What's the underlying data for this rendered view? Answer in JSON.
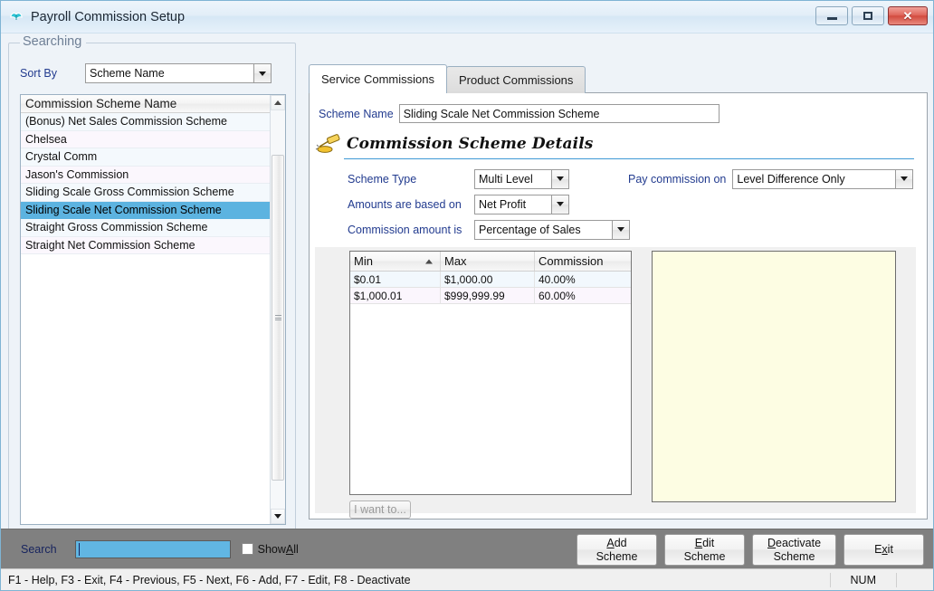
{
  "window": {
    "title": "Payroll Commission Setup",
    "icon": "butterfly-icon",
    "minimize_label": "",
    "maximize_label": "",
    "close_label": "✕"
  },
  "search_panel": {
    "legend": "Searching",
    "sort_by_label": "Sort By",
    "sort_by_value": "Scheme Name",
    "list_header": "Commission Scheme Name",
    "items": [
      "(Bonus) Net Sales Commission Scheme",
      "Chelsea",
      "Crystal Comm",
      "Jason's Commission",
      "Sliding Scale Gross Commission Scheme",
      "Sliding Scale Net Commission Scheme",
      "Straight Gross Commission Scheme",
      "Straight Net Commission Scheme"
    ],
    "selected_index": 5,
    "selection_color": "#5cb3e0"
  },
  "tabs": [
    {
      "label": "Service Commissions",
      "active": true
    },
    {
      "label": "Product Commissions",
      "active": false
    }
  ],
  "detail": {
    "scheme_name_label": "Scheme Name",
    "scheme_name_value": "Sliding Scale Net Commission Scheme",
    "section_title": "Commission Scheme Details",
    "section_icon": "gavel-icon",
    "fields": [
      {
        "label": "Scheme Type",
        "value": "Multi Level"
      },
      {
        "label": "Amounts are based on",
        "value": "Net Profit"
      },
      {
        "label": "Commission amount is",
        "value": "Percentage of Sales"
      }
    ],
    "pay_commission_label": "Pay commission on",
    "pay_commission_value": "Level Difference Only",
    "i_want_to_label": "I want to...",
    "note_panel_color": "#fdfde3"
  },
  "grid": {
    "columns": [
      "Min",
      "Max",
      "Commission"
    ],
    "sorted_column": "Min",
    "sort_direction": "asc",
    "rows": [
      {
        "min": "$0.01",
        "max": "$1,000.00",
        "commission": "40.00%"
      },
      {
        "min": "$1,000.01",
        "max": "$999,999.99",
        "commission": "60.00%"
      }
    ]
  },
  "action_bar": {
    "search_label": "Search",
    "search_value": "",
    "search_placeholder": "",
    "show_all_label_pre": "Show",
    "show_all_accel": "A",
    "show_all_label_post": "ll",
    "show_all_checked": false,
    "buttons": [
      {
        "accel": "A",
        "line1_rest": "dd",
        "line2": "Scheme",
        "name": "add-scheme"
      },
      {
        "accel": "E",
        "line1_rest": "dit",
        "line2": "Scheme",
        "name": "edit-scheme"
      },
      {
        "accel": "D",
        "line1_rest": "eactivate",
        "line2": "Scheme",
        "name": "deactivate-scheme"
      }
    ],
    "exit_pre": "E",
    "exit_accel": "x",
    "exit_post": "it"
  },
  "status_bar": {
    "hint": "F1 - Help, F3 - Exit, F4 - Previous, F5 - Next, F6 - Add, F7 - Edit, F8 - Deactivate",
    "num_indicator": "NUM"
  }
}
